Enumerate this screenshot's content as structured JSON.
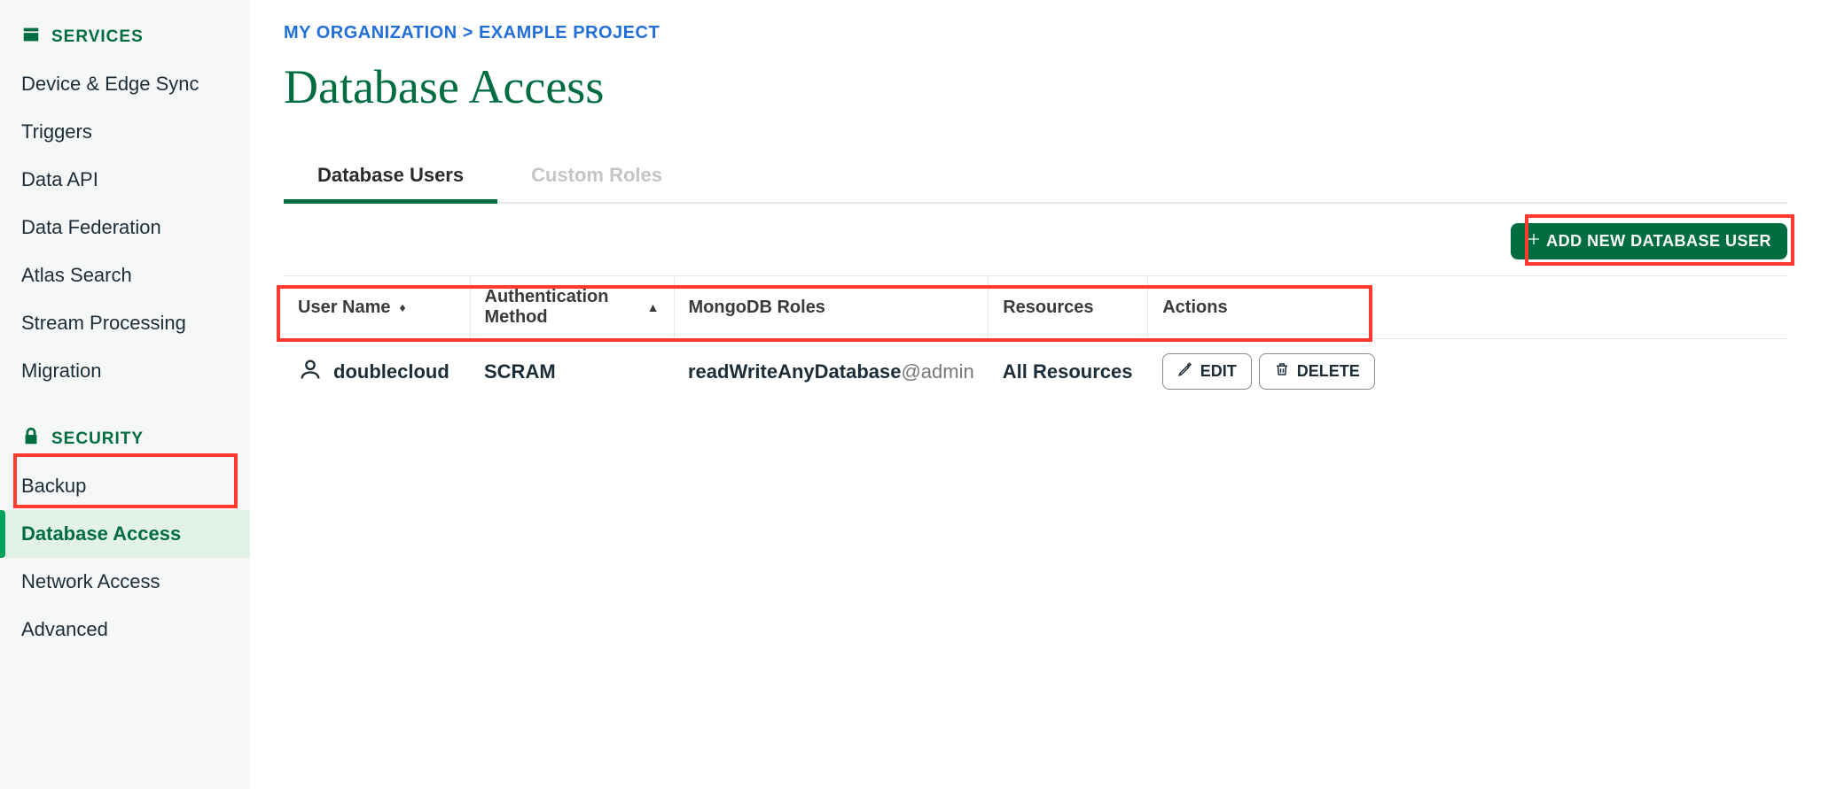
{
  "sidebar": {
    "services_header": "SERVICES",
    "services_items": [
      "Device & Edge Sync",
      "Triggers",
      "Data API",
      "Data Federation",
      "Atlas Search",
      "Stream Processing",
      "Migration"
    ],
    "security_header": "SECURITY",
    "security_items": [
      "Backup",
      "Database Access",
      "Network Access",
      "Advanced"
    ],
    "active_security_index": 1
  },
  "breadcrumb": {
    "org": "MY ORGANIZATION",
    "sep": " > ",
    "project": "EXAMPLE PROJECT"
  },
  "page": {
    "title": "Database Access"
  },
  "tabs": [
    {
      "label": "Database Users",
      "active": true
    },
    {
      "label": "Custom Roles",
      "active": false
    }
  ],
  "toolbar": {
    "add_button": "ADD NEW DATABASE USER"
  },
  "table": {
    "headers": {
      "username": "User Name",
      "auth": "Authentication Method",
      "roles": "MongoDB Roles",
      "resources": "Resources",
      "actions": "Actions"
    },
    "rows": [
      {
        "username": "doublecloud",
        "auth": "SCRAM",
        "role_main": "readWriteAnyDatabase",
        "role_suffix": "@admin",
        "resources": "All Resources",
        "edit_label": "EDIT",
        "delete_label": "DELETE"
      }
    ]
  }
}
